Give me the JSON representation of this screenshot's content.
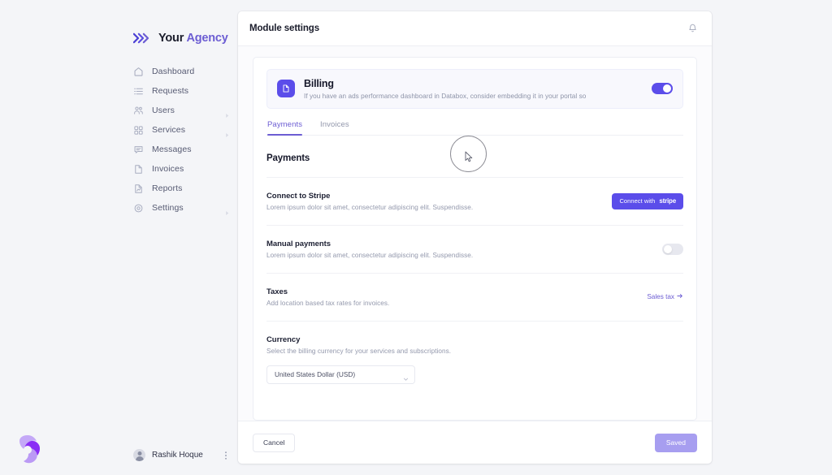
{
  "brand": {
    "name_first": "Your",
    "name_second": "Agency",
    "logo_icon": "chevrons-logo-icon",
    "accent_color": "#6c5dd3"
  },
  "watermark": {
    "icon": "tri-lobe-logo-icon"
  },
  "sidebar": {
    "items": [
      {
        "label": "Dashboard",
        "icon": "home-icon",
        "has_arrow": false
      },
      {
        "label": "Requests",
        "icon": "list-icon",
        "has_arrow": false
      },
      {
        "label": "Users",
        "icon": "users-icon",
        "has_arrow": true
      },
      {
        "label": "Services",
        "icon": "grid-icon",
        "has_arrow": true
      },
      {
        "label": "Messages",
        "icon": "chat-icon",
        "has_arrow": false
      },
      {
        "label": "Invoices",
        "icon": "document-icon",
        "has_arrow": false
      },
      {
        "label": "Reports",
        "icon": "report-icon",
        "has_arrow": false
      },
      {
        "label": "Settings",
        "icon": "gear-icon",
        "has_arrow": true
      }
    ],
    "profile": {
      "name": "Rashik Hoque",
      "avatar_icon": "avatar-icon",
      "menu_icon": "kebab-menu-icon"
    }
  },
  "header": {
    "title": "Module settings",
    "notification_icon": "bell-icon"
  },
  "billing_banner": {
    "icon": "billing-file-icon",
    "title": "Billing",
    "description": "If you have an ads performance dashboard in Databox, consider embedding it in your portal so",
    "toggle_on": true,
    "toggle_color": "#5b4dea"
  },
  "tabs": [
    {
      "label": "Payments",
      "active": true
    },
    {
      "label": "Invoices",
      "active": false
    }
  ],
  "main": {
    "section_title": "Payments",
    "rows": [
      {
        "title": "Connect to Stripe",
        "description": "Lorem ipsum dolor sit amet, consectetur adipiscing elit. Suspendisse.",
        "control": "stripe-button",
        "button_label": "Connect with",
        "button_brand": "stripe"
      },
      {
        "title": "Manual payments",
        "description": "Lorem ipsum dolor sit amet, consectetur adipiscing elit. Suspendisse.",
        "control": "toggle",
        "toggle_on": false
      },
      {
        "title": "Taxes",
        "description": "Add location based tax rates for invoices.",
        "control": "link",
        "link_label": "Sales tax",
        "link_arrow": "arrow-right-icon"
      },
      {
        "title": "Currency",
        "description": "Select the billing currency for your services and subscriptions.",
        "control": "select",
        "select_value": "United States Dollar (USD)",
        "select_caret": "chevron-down-icon"
      }
    ]
  },
  "footer": {
    "cancel_label": "Cancel",
    "save_label": "Saved"
  },
  "cursor": {
    "icon": "mouse-pointer-icon"
  }
}
